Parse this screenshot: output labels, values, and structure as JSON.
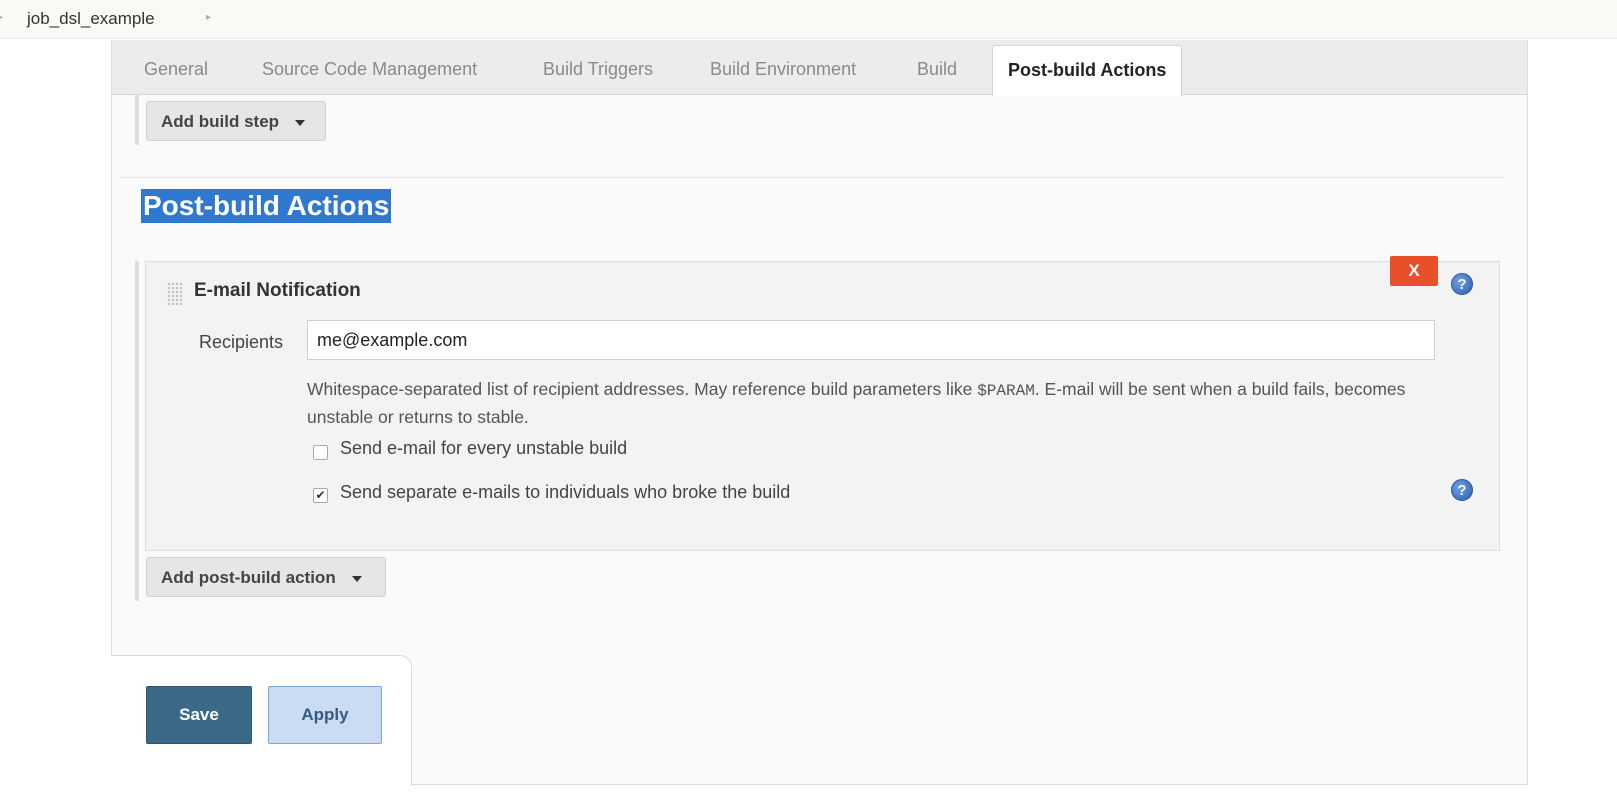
{
  "breadcrumb": {
    "items": [
      "job_dsl_example"
    ]
  },
  "tabs": [
    {
      "label": "General"
    },
    {
      "label": "Source Code Management"
    },
    {
      "label": "Build Triggers"
    },
    {
      "label": "Build Environment"
    },
    {
      "label": "Build"
    },
    {
      "label": "Post-build Actions",
      "active": true
    }
  ],
  "build_section": {
    "add_step_label": "Add build step"
  },
  "post_build": {
    "heading": "Post-build Actions",
    "email_card": {
      "title": "E-mail Notification",
      "close_label": "X",
      "recipients_label": "Recipients",
      "recipients_value": "me@example.com",
      "help_text_before": "Whitespace-separated list of recipient addresses. May reference build parameters like ",
      "help_text_code": "$PARAM",
      "help_text_after": ". E-mail will be sent when a build fails, becomes unstable or returns to stable.",
      "checkboxes": [
        {
          "label": "Send e-mail for every unstable build",
          "checked": false
        },
        {
          "label": "Send separate e-mails to individuals who broke the build",
          "checked": true
        }
      ],
      "help_icon_glyph": "?"
    },
    "add_action_label": "Add post-build action"
  },
  "actions": {
    "save_label": "Save",
    "apply_label": "Apply"
  },
  "colors": {
    "heading_highlight": "#2f78d0",
    "close_button": "#e8502b",
    "save_button": "#3a6a88",
    "apply_button": "#c9dcf3"
  }
}
